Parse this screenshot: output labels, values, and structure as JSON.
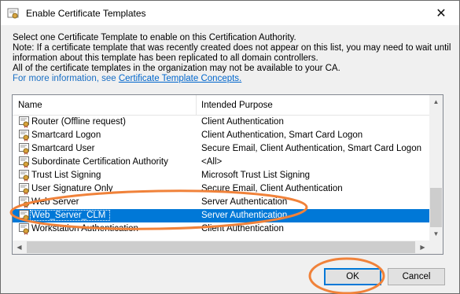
{
  "window": {
    "title": "Enable Certificate Templates",
    "close_glyph": "✕"
  },
  "description": {
    "line1": "Select one Certificate Template to enable on this Certification Authority.",
    "line2": "Note: If a certificate template that was recently created does not appear on this list, you may need to wait until",
    "line3": "information about this template has been replicated to all domain controllers.",
    "line4": "All of the certificate templates in the organization may not be available to your CA.",
    "more_info_prefix": "For more information, see ",
    "more_info_link": "Certificate Template Concepts."
  },
  "list": {
    "columns": {
      "name": "Name",
      "purpose": "Intended Purpose"
    },
    "rows": [
      {
        "name": "Router (Offline request)",
        "purpose": "Client Authentication"
      },
      {
        "name": "Smartcard Logon",
        "purpose": "Client Authentication, Smart Card Logon"
      },
      {
        "name": "Smartcard User",
        "purpose": "Secure Email, Client Authentication, Smart Card Logon"
      },
      {
        "name": "Subordinate Certification Authority",
        "purpose": "<All>"
      },
      {
        "name": "Trust List Signing",
        "purpose": "Microsoft Trust List Signing"
      },
      {
        "name": "User Signature Only",
        "purpose": "Secure Email, Client Authentication"
      },
      {
        "name": "Web Server",
        "purpose": "Server Authentication"
      },
      {
        "name": "Web_Server_CLM",
        "purpose": "Server Authentication",
        "selected": true
      },
      {
        "name": "Workstation Authentication",
        "purpose": "Client Authentication"
      }
    ],
    "selection_color": "#0078d7"
  },
  "buttons": {
    "ok": "OK",
    "cancel": "Cancel"
  },
  "annotation_color": "#f0823a"
}
